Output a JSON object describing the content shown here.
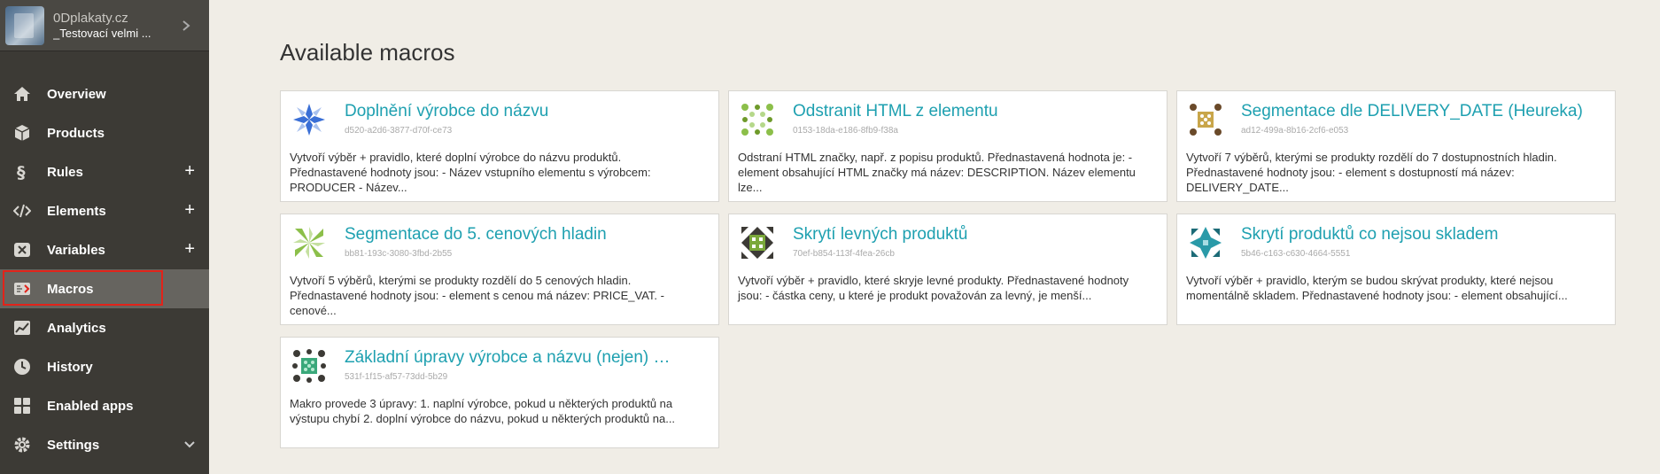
{
  "project": {
    "name": "0Dplakaty.cz",
    "subtitle": "_Testovací velmi ..."
  },
  "sidebar": {
    "items": [
      {
        "label": "Overview",
        "icon": "home-icon"
      },
      {
        "label": "Products",
        "icon": "cube-icon"
      },
      {
        "label": "Rules",
        "icon": "section-icon",
        "expand": "+"
      },
      {
        "label": "Elements",
        "icon": "code-icon",
        "expand": "+"
      },
      {
        "label": "Variables",
        "icon": "variable-icon",
        "expand": "+"
      },
      {
        "label": "Macros",
        "icon": "macro-icon",
        "active": true
      },
      {
        "label": "Analytics",
        "icon": "chart-icon"
      },
      {
        "label": "History",
        "icon": "clock-icon"
      },
      {
        "label": "Enabled apps",
        "icon": "apps-icon"
      },
      {
        "label": "Settings",
        "icon": "gear-icon",
        "expand": "chevron-down"
      }
    ]
  },
  "main": {
    "title": "Available macros",
    "macros": [
      {
        "title": "Doplnění výrobce do názvu",
        "id": "d520-a2d6-3877-d70f-ce73",
        "description": "Vytvoří výběr + pravidlo, které doplní výrobce do názvu produktů. Přednastavené hodnoty jsou: - Název vstupního elementu s výrobcem: PRODUCER - Název...",
        "icon_color": "#3a6fd6"
      },
      {
        "title": "Odstranit HTML z elementu",
        "id": "0153-18da-e186-8fb9-f38a",
        "description": "Odstraní HTML značky, např. z popisu produktů. Přednastavená hodnota je: - element obsahující HTML značky má název: DESCRIPTION. Název elementu lze...",
        "icon_color": "#6e9a2a"
      },
      {
        "title": "Segmentace dle DELIVERY_DATE (Heureka)",
        "id": "ad12-499a-8b16-2cf6-e053",
        "description": "Vytvoří 7 výběrů, kterými se produkty rozdělí do 7 dostupnostních hladin. Přednastavené hodnoty jsou: - element s dostupností má název: DELIVERY_DATE...",
        "icon_color": "#c9a64a"
      },
      {
        "title": "Segmentace do 5. cenových hladin",
        "id": "bb81-193c-3080-3fbd-2b55",
        "description": "Vytvoří 5 výběrů, kterými se produkty rozdělí do 5 cenových hladin. Přednastavené hodnoty jsou: - element s cenou má název: PRICE_VAT. - cenové...",
        "icon_color": "#8cbf4a"
      },
      {
        "title": "Skrytí levných produktů",
        "id": "70ef-b854-113f-4fea-26cb",
        "description": "Vytvoří výběr + pravidlo, které skryje levné produkty. Přednastavené hodnoty jsou: - částka ceny, u které je produkt považován za levný, je menší...",
        "icon_color": "#7aa83a"
      },
      {
        "title": "Skrytí produktů co nejsou skladem",
        "id": "5b46-c163-c630-4664-5551",
        "description": "Vytvoří výběr + pravidlo, kterým se budou skrývat produkty, které nejsou momentálně skladem. Přednastavené hodnoty jsou: - element obsahující...",
        "icon_color": "#2a9aa8"
      },
      {
        "title": "Základní úpravy výrobce a názvu (nejen) pro Heureku",
        "id": "531f-1f15-af57-73dd-5b29",
        "description": "Makro provede 3 úpravy: 1. naplní výrobce, pokud u některých produktů na výstupu chybí 2. doplní výrobce do názvu, pokud u některých produktů na...",
        "icon_color": "#3aa87a"
      }
    ]
  }
}
